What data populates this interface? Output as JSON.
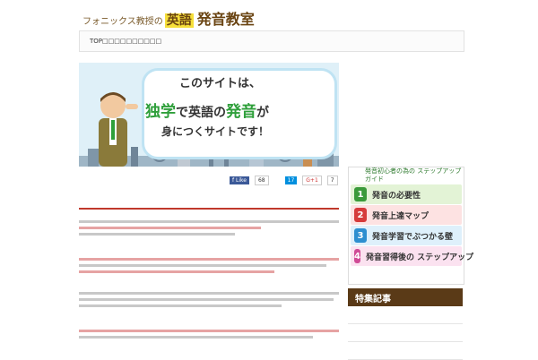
{
  "header": {
    "site_title_small": "フォニックス教授の",
    "site_title_highlight": "英語",
    "site_title_big": "発音教室"
  },
  "nav": {
    "items": [
      {
        "label": "TOP□□□□□□□□□□"
      },
      {
        "label": ""
      },
      {
        "label": ""
      },
      {
        "label": ""
      },
      {
        "label": ""
      }
    ]
  },
  "hero": {
    "line1": "このサイトは、",
    "line2_a": "独学",
    "line2_b": "で英語の",
    "line2_c": "発音",
    "line2_d": "が",
    "line3": "身につくサイトです！"
  },
  "social": {
    "like_count": "68",
    "hatena_label": "",
    "hatena_count": "17",
    "gplus_label": "G+1",
    "gplus_count": "7"
  },
  "article": {
    "title": ""
  },
  "sidebar": {
    "guide_title": "発音初心者の為の ステップアップガイド",
    "steps": [
      {
        "num": "1",
        "label": "発音の必要性"
      },
      {
        "num": "2",
        "label": "発音上達マップ"
      },
      {
        "num": "3",
        "label": "発音学習でぶつかる壁"
      },
      {
        "num": "4",
        "label": "発音習得後の ステップアップ"
      }
    ],
    "feature_heading": "特集記事",
    "feature_items": [
      {
        "label": ""
      },
      {
        "label": ""
      },
      {
        "label": ""
      }
    ]
  },
  "colors": {
    "accent_red": "#c0392b",
    "brand_brown": "#5a3a17",
    "highlight_yellow": "#f6df3a",
    "green": "#2e9f3a"
  }
}
